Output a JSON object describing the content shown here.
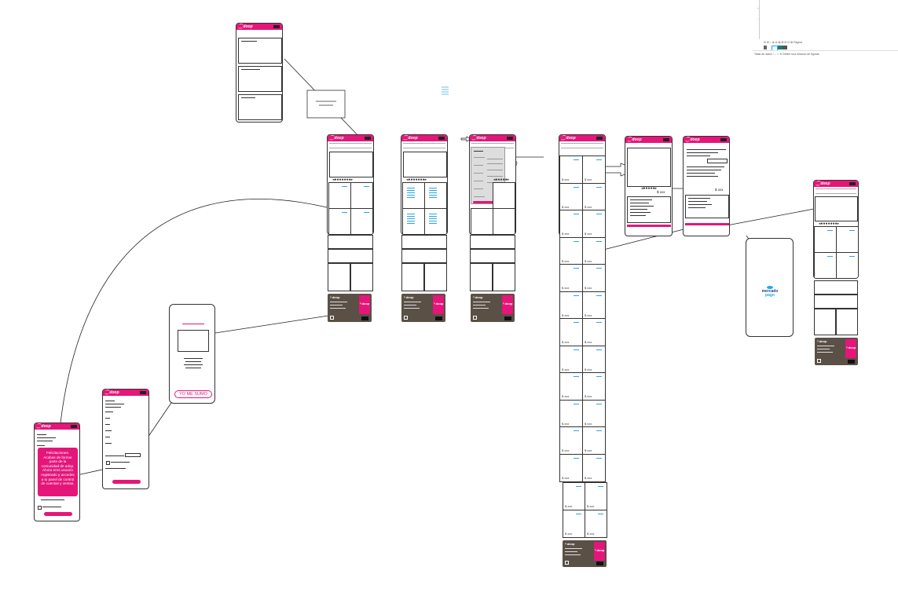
{
  "brand": {
    "logo": "⁐ doop",
    "footer_logo": "ᵑ doop"
  },
  "colors": {
    "accent": "#e6157a",
    "footer": "#5a5046",
    "link": "#29a8e0"
  },
  "price_label": "$ xxx",
  "carousel_dots": "◂●●●●●●●▸",
  "carousel_dots_short": "◂●●●●●▸",
  "popup_text": "Felicitaciones. Acabas de formar parte de la comunidad de adop. Ahora eres usuario registrado y accedes a tu panel de control de cuentas y ventas.",
  "button_label": "YO ME SUMO",
  "payment_logo": {
    "line1": "mercado",
    "line2": "pago"
  },
  "footer_badge": "ᵑ doop",
  "toolbar": {
    "row1": "⊟ ⊞ ⌕ ⊕ ⊖ ⊠ ⊞ ⊟ ⊡ ⊠ Página",
    "row2": "Tabla de datos  ↑  ↓  ⌂  ⟲ Definir una relacion de figuras"
  }
}
